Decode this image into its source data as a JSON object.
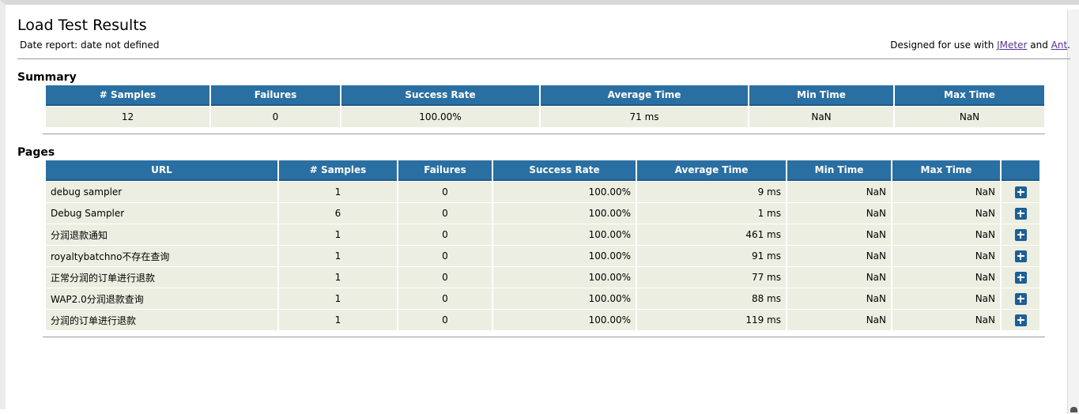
{
  "page": {
    "title": "Load Test Results",
    "date_report": "Date report: date not defined",
    "designed_prefix": "Designed for use with ",
    "designed_link1": "JMeter",
    "designed_and": " and ",
    "designed_link2": "Ant",
    "designed_suffix": "."
  },
  "summary": {
    "heading": "Summary",
    "headers": [
      "# Samples",
      "Failures",
      "Success Rate",
      "Average Time",
      "Min Time",
      "Max Time"
    ],
    "row": [
      "12",
      "0",
      "100.00%",
      "71 ms",
      "NaN",
      "NaN"
    ]
  },
  "pages": {
    "heading": "Pages",
    "headers": [
      "URL",
      "# Samples",
      "Failures",
      "Success Rate",
      "Average Time",
      "Min Time",
      "Max Time",
      ""
    ],
    "rows": [
      [
        "debug sampler",
        "1",
        "0",
        "100.00%",
        "9 ms",
        "NaN",
        "NaN"
      ],
      [
        "Debug Sampler",
        "6",
        "0",
        "100.00%",
        "1 ms",
        "NaN",
        "NaN"
      ],
      [
        "分润退款通知",
        "1",
        "0",
        "100.00%",
        "461 ms",
        "NaN",
        "NaN"
      ],
      [
        "royaltybatchno不存在查询",
        "1",
        "0",
        "100.00%",
        "91 ms",
        "NaN",
        "NaN"
      ],
      [
        "正常分润的订单进行退款",
        "1",
        "0",
        "100.00%",
        "77 ms",
        "NaN",
        "NaN"
      ],
      [
        "WAP2.0分润退款查询",
        "1",
        "0",
        "100.00%",
        "88 ms",
        "NaN",
        "NaN"
      ],
      [
        "分润的订单进行退款",
        "1",
        "0",
        "100.00%",
        "119 ms",
        "NaN",
        "NaN"
      ]
    ]
  },
  "colors": {
    "header_bg": "#2a6fa2",
    "cell_bg": "#eceee2",
    "link": "#5a3393",
    "expand_button": "#1c5e96"
  },
  "icons": {
    "expand": "plus-icon"
  }
}
